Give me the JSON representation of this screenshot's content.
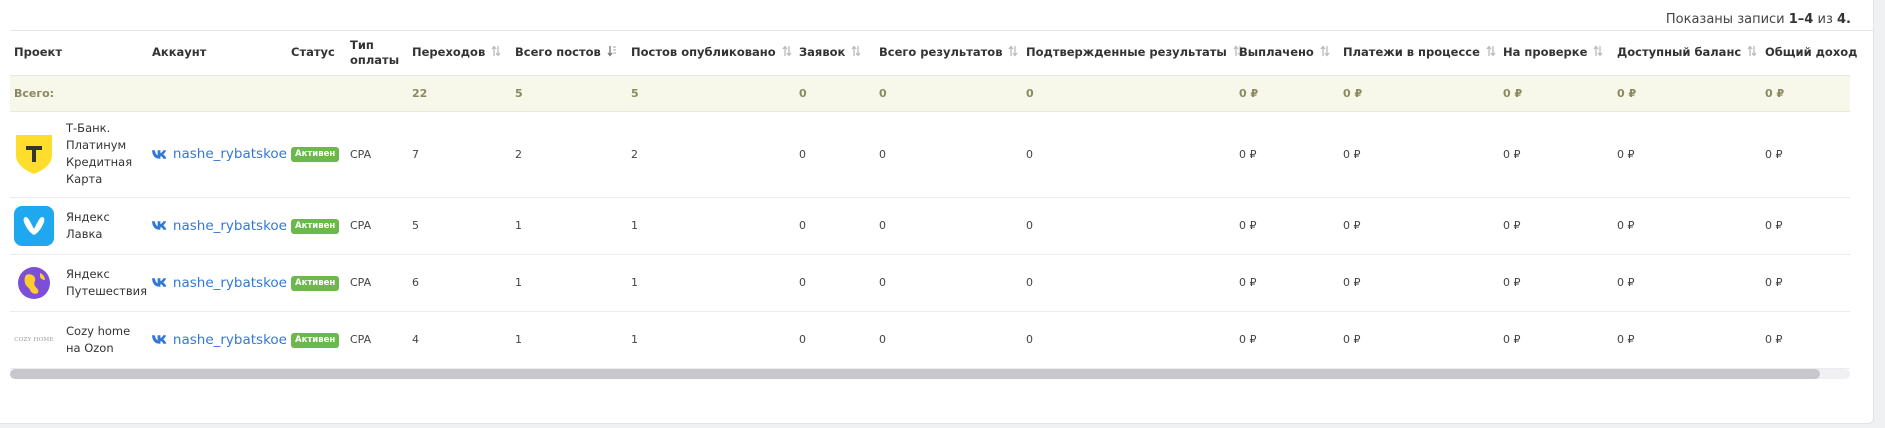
{
  "summary": {
    "prefix": "Показаны записи",
    "range": "1–4",
    "of": "из",
    "total": "4."
  },
  "columns": [
    {
      "label": "Проект",
      "sortable": false
    },
    {
      "label": "Аккаунт",
      "sortable": false
    },
    {
      "label": "Статус",
      "sortable": false
    },
    {
      "label": "Тип оплаты",
      "sortable": false
    },
    {
      "label": "Переходов",
      "sortable": true
    },
    {
      "label": "Всего постов",
      "sortable": true,
      "active": true
    },
    {
      "label": "Постов опубликовано",
      "sortable": true
    },
    {
      "label": "Заявок",
      "sortable": true
    },
    {
      "label": "Всего результатов",
      "sortable": true
    },
    {
      "label": "Подтвержденные результаты",
      "sortable": true
    },
    {
      "label": "Выплачено",
      "sortable": true
    },
    {
      "label": "Платежи в процессе",
      "sortable": true
    },
    {
      "label": "На проверке",
      "sortable": true
    },
    {
      "label": "Доступный баланс",
      "sortable": true
    },
    {
      "label": "Общий доход",
      "sortable": false
    }
  ],
  "totals": {
    "label": "Всего:",
    "values": [
      "22",
      "5",
      "5",
      "0",
      "0",
      "0",
      "0 ₽",
      "0 ₽",
      "0 ₽",
      "0 ₽",
      "0 ₽"
    ]
  },
  "rows": [
    {
      "project": "Т-Банк. Платинум Кредитная Карта",
      "logo": "tbank-logo",
      "account": "nashe_rybatskoe",
      "status": "Активен",
      "payment": "CPA",
      "values": [
        "7",
        "2",
        "2",
        "0",
        "0",
        "0",
        "0 ₽",
        "0 ₽",
        "0 ₽",
        "0 ₽",
        "0 ₽"
      ]
    },
    {
      "project": "Яндекс Лавка",
      "logo": "yandex-lavka-logo",
      "account": "nashe_rybatskoe",
      "status": "Активен",
      "payment": "CPA",
      "values": [
        "5",
        "1",
        "1",
        "0",
        "0",
        "0",
        "0 ₽",
        "0 ₽",
        "0 ₽",
        "0 ₽",
        "0 ₽"
      ]
    },
    {
      "project": "Яндекс Путешествия",
      "logo": "yandex-travel-logo",
      "account": "nashe_rybatskoe",
      "status": "Активен",
      "payment": "CPA",
      "values": [
        "6",
        "1",
        "1",
        "0",
        "0",
        "0",
        "0 ₽",
        "0 ₽",
        "0 ₽",
        "0 ₽",
        "0 ₽"
      ]
    },
    {
      "project": "Cozy home на Ozon",
      "logo": "cozy-home-logo",
      "logo_text": "COZY HOME",
      "account": "nashe_rybatskoe",
      "status": "Активен",
      "payment": "CPA",
      "values": [
        "4",
        "1",
        "1",
        "0",
        "0",
        "0",
        "0 ₽",
        "0 ₽",
        "0 ₽",
        "0 ₽",
        "0 ₽"
      ]
    }
  ],
  "colors": {
    "link": "#3478d6",
    "badge": "#6cb84e",
    "total_bg": "#f7f7ea",
    "tbank": "#ffdd2d",
    "lavka": "#1fa8f0",
    "travel": "#7d4fd8"
  }
}
